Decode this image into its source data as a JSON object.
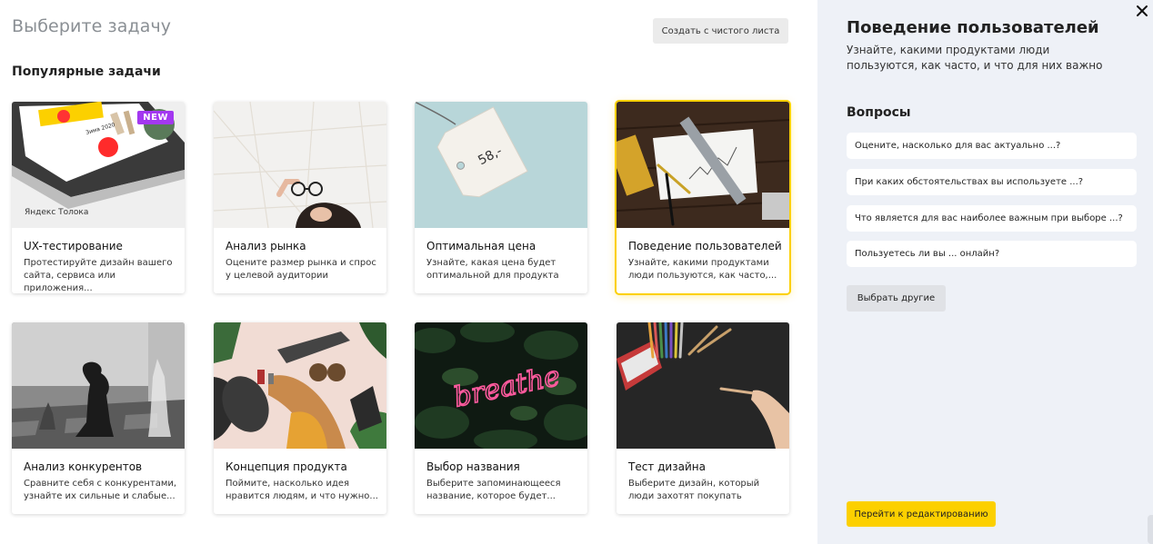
{
  "header": {
    "title": "Выберите задачу",
    "blank_button": "Создать с чистого листа",
    "section_title": "Популярные задачи"
  },
  "cards": [
    {
      "title": "UX-тестирование",
      "desc": "Протестируйте дизайн вашего сайта, сервиса или приложения...",
      "badge": "NEW",
      "image_brand": "Яндекс Толока",
      "image_screen_text": "Зима 2020"
    },
    {
      "title": "Анализ рынка",
      "desc": "Оцените размер рынка и спрос у целевой аудитории"
    },
    {
      "title": "Оптимальная цена",
      "desc": "Узнайте, какая цена будет оптимальной для продукта",
      "image_tag_text": "58,-"
    },
    {
      "title": "Поведение пользователей",
      "desc": "Узнайте, какими продуктами люди пользуются, как часто,...",
      "selected": true
    },
    {
      "title": "Анализ конкурентов",
      "desc": "Сравните себя с конкурентами, узнайте их сильные и слабые..."
    },
    {
      "title": "Концепция продукта",
      "desc": "Поймите, насколько идея нравится людям, и что нужно..."
    },
    {
      "title": "Выбор названия",
      "desc": "Выберите запоминающееся название, которое будет...",
      "image_neon_text": "breathe"
    },
    {
      "title": "Тест дизайна",
      "desc": "Выберите дизайн, который люди захотят покупать"
    }
  ],
  "panel": {
    "title": "Поведение пользователей",
    "subtitle": "Узнайте, какими продуктами люди пользуются, как часто, и что для них важно",
    "questions_title": "Вопросы",
    "questions": [
      "Оцените, насколько для вас актуально ...?",
      "При каких обстоятельствах вы используете ...?",
      "Что является для вас наиболее важным при выборе ...?",
      "Пользуетесь ли вы ... онлайн?"
    ],
    "more_button": "Выбрать другие",
    "edit_button": "Перейти к редактированию"
  },
  "colors": {
    "accent": "#fcd000",
    "badge": "#a338f0",
    "panel_bg": "#eef1f7"
  }
}
